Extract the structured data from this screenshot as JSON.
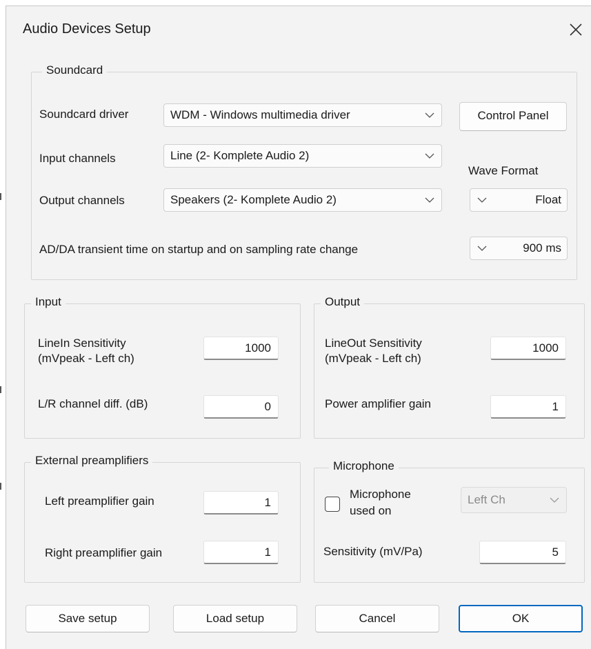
{
  "window": {
    "title": "Audio Devices Setup"
  },
  "soundcard": {
    "legend": "Soundcard",
    "driver_label": "Soundcard driver",
    "driver_value": "WDM - Windows multimedia driver",
    "control_panel_label": "Control Panel",
    "input_label": "Input channels",
    "input_value": "Line (2- Komplete Audio 2)",
    "output_label": "Output channels",
    "output_value": "Speakers (2- Komplete Audio 2)",
    "wave_format_label": "Wave Format",
    "wave_format_value": "Float",
    "transient_label": "AD/DA transient time on startup and on sampling rate change",
    "transient_value": "900 ms"
  },
  "input": {
    "legend": "Input",
    "linein_label_1": "LineIn Sensitivity",
    "linein_label_2": "(mVpeak - Left ch)",
    "linein_value": "1000",
    "lr_label": "L/R channel diff. (dB)",
    "lr_value": "0"
  },
  "output": {
    "legend": "Output",
    "lineout_label_1": "LineOut Sensitivity",
    "lineout_label_2": "(mVpeak - Left ch)",
    "lineout_value": "1000",
    "power_label": "Power amplifier gain",
    "power_value": "1"
  },
  "preamps": {
    "legend": "External preamplifiers",
    "left_label": "Left preamplifier gain",
    "left_value": "1",
    "right_label": "Right preamplifier gain",
    "right_value": "1"
  },
  "microphone": {
    "legend": "Microphone",
    "used_label_1": "Microphone",
    "used_label_2": "used on",
    "used_checked": false,
    "channel_value": "Left Ch",
    "sensitivity_label": "Sensitivity (mV/Pa)",
    "sensitivity_value": "5"
  },
  "buttons": {
    "save": "Save setup",
    "load": "Load setup",
    "cancel": "Cancel",
    "ok": "OK"
  },
  "icons": {
    "close": "close-icon",
    "chevron": "chevron-down-icon"
  },
  "colors": {
    "accent": "#0067c0",
    "window_bg": "#f3f3f3"
  }
}
